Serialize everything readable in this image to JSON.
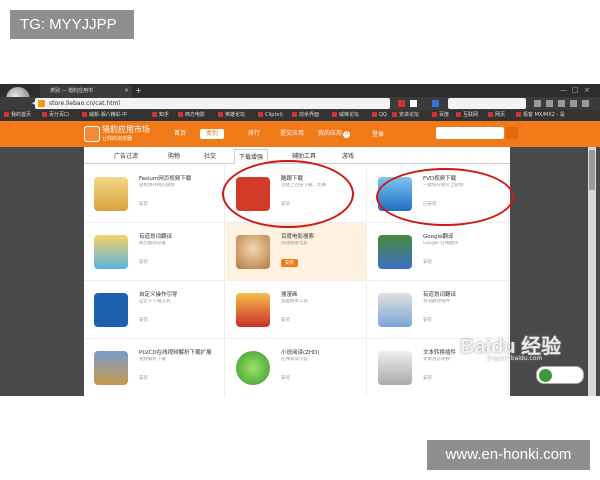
{
  "watermarks": {
    "top_tag": "TG: MYYJJPP",
    "bottom_url": "www.en-honki.com",
    "baidu_logo": "Baidu 经验",
    "baidu_url": "jingyan.baidu.com"
  },
  "browser": {
    "tab_title": "类别 — 猎豹应用市",
    "url": "store.liebao.cn/cat.html",
    "bookmarks": [
      "我的首页",
      "百分百口",
      "威新·湘八精彩·中",
      "知乎",
      "西方电影",
      "英雄论坛",
      "Clip(el)",
      "前余界面",
      "威锋论坛",
      "QQ",
      "安卓论坛",
      "百度",
      "互联网",
      "网页",
      "极客 MX/MX2 - 是"
    ]
  },
  "site": {
    "title": "猎豹应用市场",
    "subtitle": "让你的浏览器",
    "nav": [
      {
        "label": "首页",
        "active": false
      },
      {
        "label": "类别",
        "active": true
      },
      {
        "label": "排行",
        "active": false
      },
      {
        "label": "提交应用",
        "active": false
      },
      {
        "label": "我的应用",
        "active": false,
        "badge": "0"
      }
    ],
    "login": "登录"
  },
  "categories": [
    {
      "label": "广告过滤",
      "active": false
    },
    {
      "label": "购物",
      "active": false
    },
    {
      "label": "社交",
      "active": false
    },
    {
      "label": "下载增强",
      "active": true
    },
    {
      "label": "辅助工具",
      "active": false
    },
    {
      "label": "游戏",
      "active": false
    }
  ],
  "apps": [
    {
      "name": "Fasium网页视频下载",
      "desc": "轻松保存网页视频",
      "action": "安装",
      "icon": "folder-download-icon",
      "highlight": false
    },
    {
      "name": "酷跟下载",
      "desc": "迅捷上百倍下载，比赛",
      "action": "安装",
      "icon": "download-icon",
      "highlight": false
    },
    {
      "name": "FVD视频下载",
      "desc": "一键保存网页上视频",
      "action": "已安装",
      "icon": "blue-arrow-down-icon",
      "highlight": false
    },
    {
      "name": "有道划词翻译",
      "desc": "网页翻译必备",
      "action": "安装",
      "icon": "translate-icon",
      "highlight": false
    },
    {
      "name": "百度电影搜索",
      "desc": "快速搜索电影",
      "action": "安装",
      "icon": "movie-portrait-icon",
      "highlight": true
    },
    {
      "name": "Google翻译",
      "desc": "Google 在线翻译",
      "action": "安装",
      "icon": "google-translate-icon",
      "highlight": false
    },
    {
      "name": "自定义操作引导",
      "desc": "自定义下载方式",
      "action": "安装",
      "icon": "arrow-right-icon",
      "highlight": false
    },
    {
      "name": "搜漫画",
      "desc": "漫画搜索工具",
      "action": "安装",
      "icon": "comic-icon",
      "highlight": false
    },
    {
      "name": "有道划词翻译",
      "desc": "有道翻译插件",
      "action": "安装",
      "icon": "magnifier-book-icon",
      "highlight": false
    },
    {
      "name": "PLVCD在线视频解析下载扩展",
      "desc": "视频解析下载",
      "action": "安装",
      "icon": "owl-icon",
      "highlight": false
    },
    {
      "name": "小说阅读(ZHD)",
      "desc": "在线阅读小说",
      "action": "安装",
      "icon": "green-smiley-icon",
      "highlight": false
    },
    {
      "name": "文本转换插件",
      "desc": "文本语音转换",
      "action": "安装",
      "icon": "text-speech-icon",
      "highlight": false
    }
  ],
  "colors": {
    "accent": "#f07918",
    "annotation_red": "#d01818"
  }
}
